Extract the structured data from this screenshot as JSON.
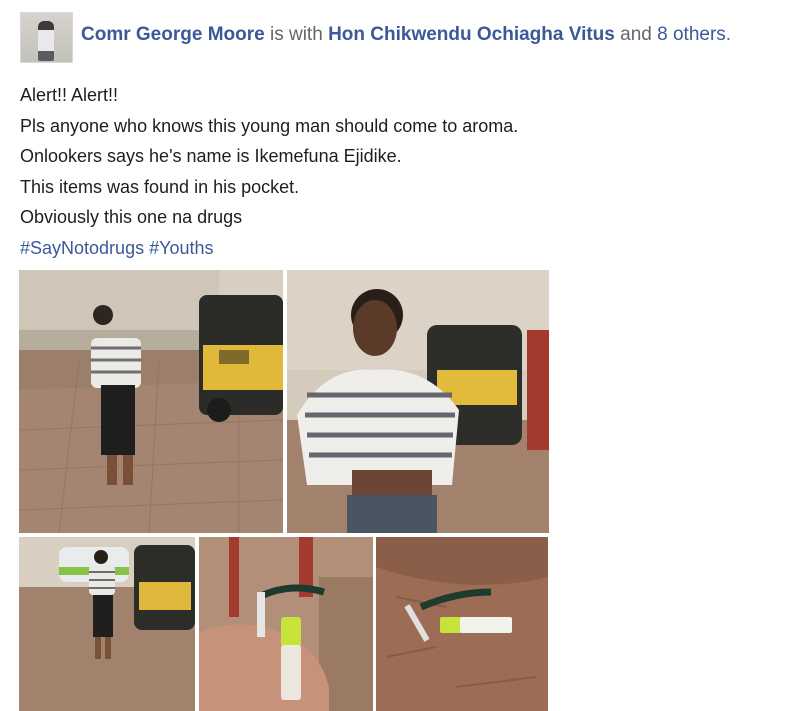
{
  "post": {
    "author": "Comr George Moore",
    "is_with_text": "is with",
    "tagged_person": "Hon Chikwendu Ochiagha Vitus",
    "and_text": "and",
    "others_link": "8 others",
    "period": ".",
    "lines": [
      "Alert!! Alert!!",
      "Pls  anyone who knows this young man should come to aroma.",
      "Onlookers says he's name is Ikemefuna Ejidike.",
      "This items was found in his pocket.",
      "Obviously this one na drugs"
    ],
    "hashtags": [
      "#SayNotodrugs",
      "#Youths"
    ]
  },
  "photos": [
    {
      "name": "photo-man-standing-tricycle"
    },
    {
      "name": "photo-man-closeup"
    },
    {
      "name": "photo-man-street"
    },
    {
      "name": "photo-items-in-hand"
    },
    {
      "name": "photo-items-on-ground"
    }
  ]
}
